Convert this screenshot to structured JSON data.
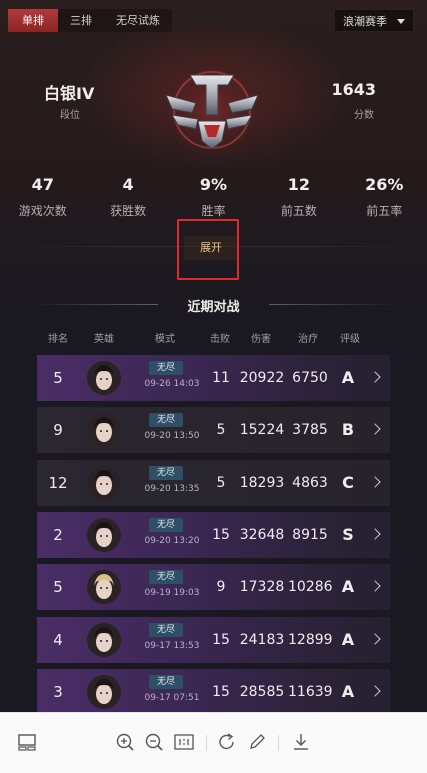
{
  "tabs": [
    {
      "label": "单排",
      "active": true
    },
    {
      "label": "三排",
      "active": false
    },
    {
      "label": "无尽试炼",
      "active": false
    }
  ],
  "season_select": {
    "value": "浪潮赛季"
  },
  "rank": {
    "name": "白银IV",
    "label": "段位"
  },
  "score": {
    "value": "1643",
    "label": "分数"
  },
  "stats": [
    {
      "value": "47",
      "label": "游戏次数"
    },
    {
      "value": "4",
      "label": "获胜数"
    },
    {
      "value": "9%",
      "label": "胜率"
    },
    {
      "value": "12",
      "label": "前五数"
    },
    {
      "value": "26%",
      "label": "前五率"
    }
  ],
  "expand_label": "展开",
  "recent": {
    "title": "近期对战",
    "columns": [
      "排名",
      "英雄",
      "模式",
      "击败",
      "伤害",
      "治疗",
      "评级"
    ]
  },
  "matches": [
    {
      "rank": "5",
      "mode": "无尽",
      "date": "09-26 14:03",
      "kills": "11",
      "damage": "20922",
      "heal": "6750",
      "grade": "A",
      "style": "purple",
      "hero_icon": "female-hero-avatar"
    },
    {
      "rank": "9",
      "mode": "无尽",
      "date": "09-20 13:50",
      "kills": "5",
      "damage": "15224",
      "heal": "3785",
      "grade": "B",
      "style": "dark",
      "hero_icon": "female-hero-avatar"
    },
    {
      "rank": "12",
      "mode": "无尽",
      "date": "09-20 13:35",
      "kills": "5",
      "damage": "18293",
      "heal": "4863",
      "grade": "C",
      "style": "dark",
      "hero_icon": "female-hero-avatar"
    },
    {
      "rank": "2",
      "mode": "无尽",
      "date": "09-20 13:20",
      "kills": "15",
      "damage": "32648",
      "heal": "8915",
      "grade": "S",
      "style": "purple",
      "hero_icon": "male-hero-avatar"
    },
    {
      "rank": "5",
      "mode": "无尽",
      "date": "09-19 19:03",
      "kills": "9",
      "damage": "17328",
      "heal": "10286",
      "grade": "A",
      "style": "purple",
      "hero_icon": "blonde-hero-avatar"
    },
    {
      "rank": "4",
      "mode": "无尽",
      "date": "09-17 13:53",
      "kills": "15",
      "damage": "24183",
      "heal": "12899",
      "grade": "A",
      "style": "purple",
      "hero_icon": "female-hero-avatar"
    },
    {
      "rank": "3",
      "mode": "无尽",
      "date": "09-17 07:51",
      "kills": "15",
      "damage": "28585",
      "heal": "11639",
      "grade": "A",
      "style": "purple",
      "hero_icon": "female-hero-avatar"
    }
  ],
  "toolbar_icons": [
    "thumbnail-icon",
    "zoom-in-icon",
    "zoom-out-icon",
    "actual-size-icon",
    "rotate-icon",
    "edit-icon",
    "download-icon"
  ],
  "colors": {
    "accent_red": "#b23a3a",
    "grade_A": "#c9a3ff",
    "grade_S": "#f0c23c",
    "highlight_box": "#e02a2a"
  }
}
